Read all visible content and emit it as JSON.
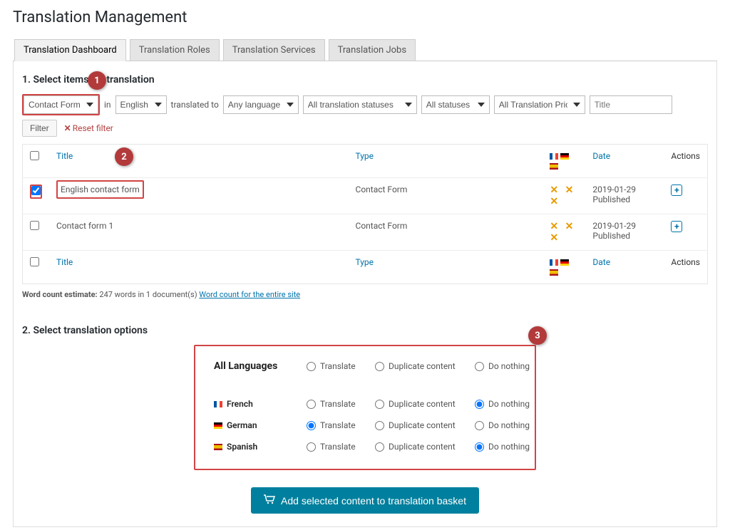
{
  "page": {
    "title": "Translation Management"
  },
  "tabs": [
    {
      "label": "Translation Dashboard"
    },
    {
      "label": "Translation Roles"
    },
    {
      "label": "Translation Services"
    },
    {
      "label": "Translation Jobs"
    }
  ],
  "section1": {
    "heading": "1. Select items for translation"
  },
  "filters": {
    "type_select": "Contact Form",
    "in_label": "in",
    "lang_select": "English",
    "translated_to_label": "translated to",
    "any_lang_select": "Any language",
    "status_select": "All translation statuses",
    "poststatus_select": "All statuses",
    "priority_select": "All Translation Priorities",
    "title_placeholder": "Title",
    "filter_button": "Filter",
    "reset_label": "Reset filter"
  },
  "columns": {
    "title": "Title",
    "type": "Type",
    "date": "Date",
    "actions": "Actions"
  },
  "rows": [
    {
      "checked": true,
      "title": "English contact form",
      "type": "Contact Form",
      "date": "2019-01-29",
      "status": "Published"
    },
    {
      "checked": false,
      "title": "Contact form 1",
      "type": "Contact Form",
      "date": "2019-01-29",
      "status": "Published"
    }
  ],
  "wordcount": {
    "label": "Word count estimate:",
    "text": "247 words in 1 document(s)",
    "link": "Word count for the entire site"
  },
  "section2": {
    "heading": "2. Select translation options"
  },
  "options": {
    "all_label": "All Languages",
    "translate": "Translate",
    "duplicate": "Duplicate content",
    "nothing": "Do nothing",
    "langs": [
      {
        "name": "French",
        "flag": "fr",
        "selected": "nothing"
      },
      {
        "name": "German",
        "flag": "de",
        "selected": "translate"
      },
      {
        "name": "Spanish",
        "flag": "es",
        "selected": "nothing"
      }
    ]
  },
  "basket_button": "Add selected content to translation basket",
  "annotations": {
    "b1": "1",
    "b2": "2",
    "b3": "3"
  }
}
